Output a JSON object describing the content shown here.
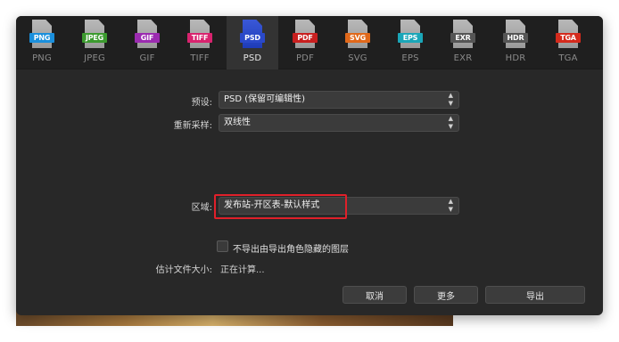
{
  "formats": [
    {
      "badge": "PNG",
      "label": "PNG",
      "color": "#1a8fdc",
      "active": false
    },
    {
      "badge": "JPEG",
      "label": "JPEG",
      "color": "#3b9a2e",
      "active": false
    },
    {
      "badge": "GIF",
      "label": "GIF",
      "color": "#9b2bb0",
      "active": false
    },
    {
      "badge": "TIFF",
      "label": "TIFF",
      "color": "#d8236e",
      "active": false
    },
    {
      "badge": "PSD",
      "label": "PSD",
      "color": "#2a49c9",
      "active": true
    },
    {
      "badge": "PDF",
      "label": "PDF",
      "color": "#c81f1f",
      "active": false
    },
    {
      "badge": "SVG",
      "label": "SVG",
      "color": "#e0681a",
      "active": false
    },
    {
      "badge": "EPS",
      "label": "EPS",
      "color": "#1aa6b8",
      "active": false
    },
    {
      "badge": "EXR",
      "label": "EXR",
      "color": "#555555",
      "active": false
    },
    {
      "badge": "HDR",
      "label": "HDR",
      "color": "#555555",
      "active": false
    },
    {
      "badge": "TGA",
      "label": "TGA",
      "color": "#d42a1c",
      "active": false
    }
  ],
  "preset": {
    "label": "预设:",
    "value": "PSD (保留可编辑性)"
  },
  "resample": {
    "label": "重新采样:",
    "value": "双线性"
  },
  "area": {
    "label": "区域:",
    "value": "发布站-开区表-默认样式"
  },
  "hide_layers": {
    "label": "不导出由导出角色隐藏的图层",
    "checked": false
  },
  "estimated_size": {
    "label": "估计文件大小:",
    "value": "正在计算..."
  },
  "buttons": {
    "cancel": "取消",
    "more": "更多",
    "export": "导出"
  },
  "colors": {
    "highlight": "#e0202a",
    "dialog_bg": "#282828"
  }
}
